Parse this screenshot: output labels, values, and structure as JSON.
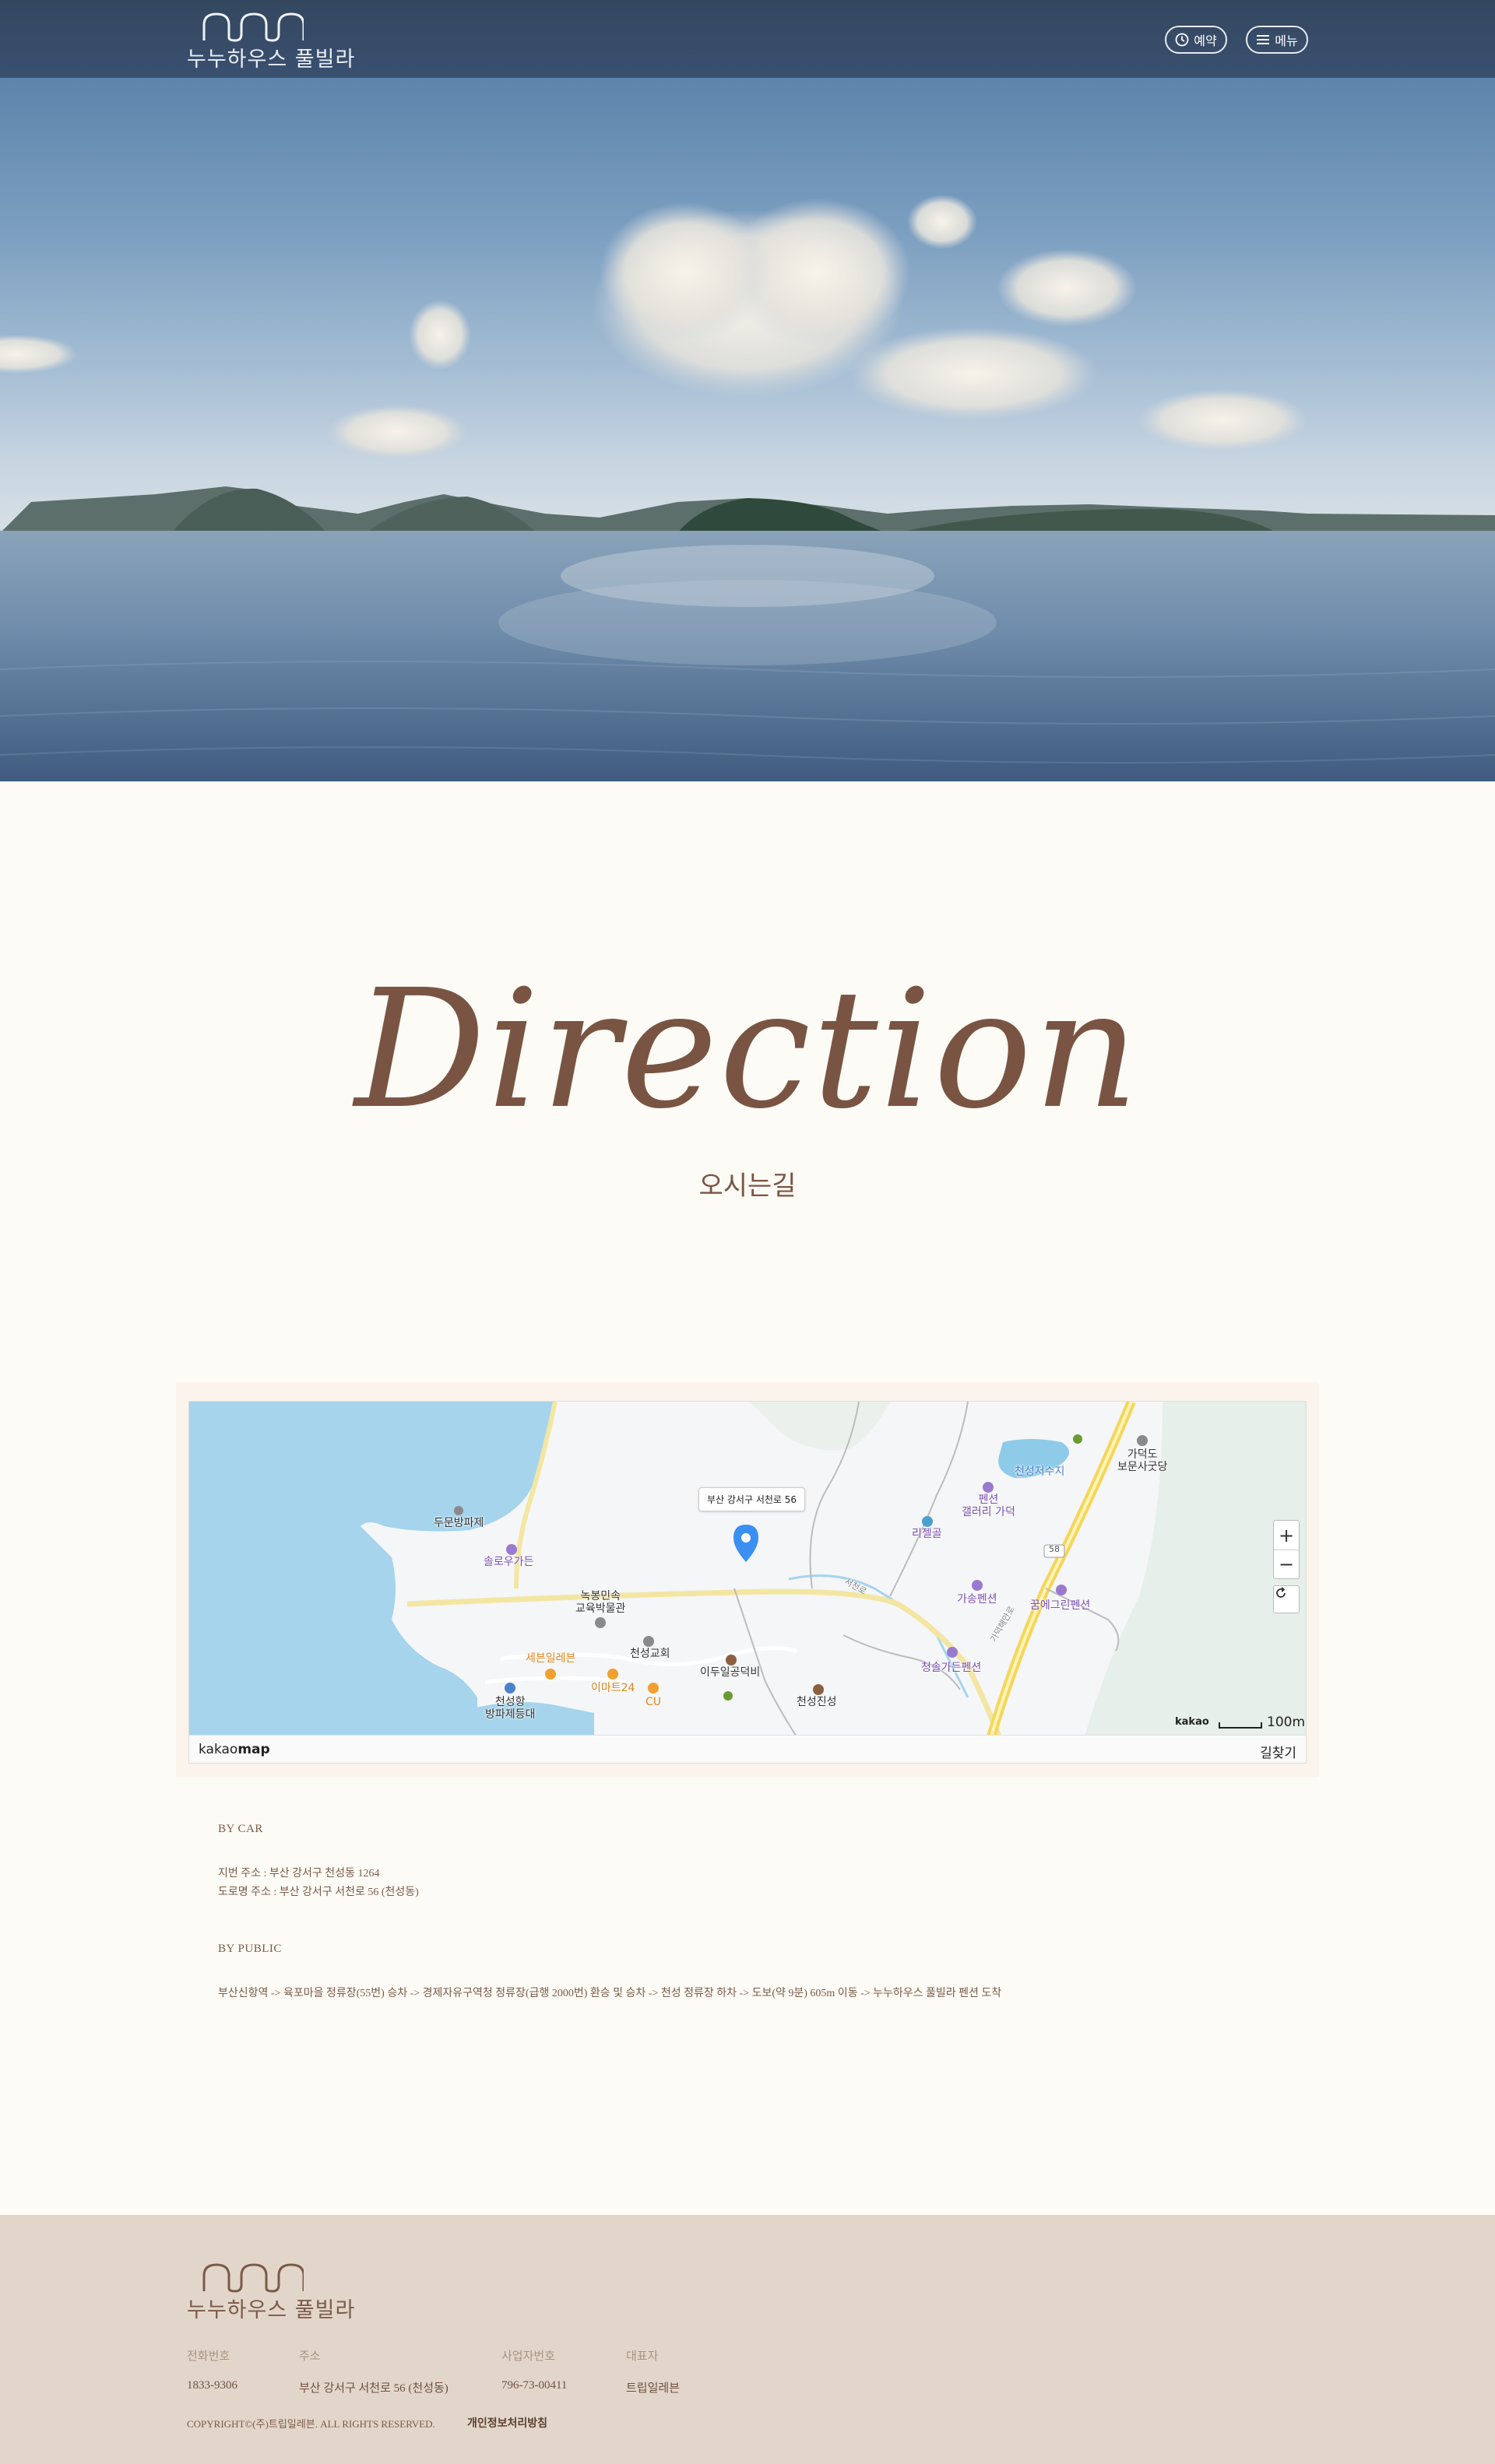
{
  "header": {
    "logo_text": "누누하우스 풀빌라",
    "reserve_label": "예약",
    "menu_label": "메뉴"
  },
  "section": {
    "title_script": "Direction",
    "title_kr": "오시는길"
  },
  "map": {
    "marker_address": "부산 강서구 서천로 56",
    "provider_logo_plain": "kakao",
    "provider_logo_bold": "map",
    "find_route": "길찾기",
    "scale_brand": "kakao",
    "scale_label": "100m",
    "zoom_in": "+",
    "zoom_out": "−",
    "labels": {
      "l1": "두문방파제",
      "l2": "솔로우가든",
      "l3": "녹봉민속\n교육박물관",
      "l4": "천성교회",
      "l5": "세븐일레븐",
      "l6": "이마트24",
      "l7": "CU",
      "l8": "천성항\n방파제등대",
      "l9": "이두일공덕비",
      "l10": "천성진성",
      "l11": "리젤골",
      "l12": "펜션\n갤러리 가덕",
      "l13": "천성저수지",
      "l14": "가덕도\n보문사굿당",
      "l15": "가송펜션",
      "l16": "꿈에그린펜션",
      "l17": "청솔가든펜션",
      "l18": "가덕해안로",
      "l19": "서천로",
      "l20": "58"
    }
  },
  "directions": {
    "by_car_title": "BY CAR",
    "lot_address": "지번 주소 : 부산 강서구 천성동 1264",
    "road_address": "도로명 주소 : 부산 강서구 서천로 56 (천성동)",
    "by_public_title": "BY PUBLIC",
    "public_route": "부산신항역 -> 육포마을 정류장(55번) 승차 -> 경제자유구역청 정류장(급행 2000번) 환승 및 승차 -> 천성 정류장 하차 -> 도보(약 9분) 605m 이동 -> 누누하우스 풀빌라 펜션 도착"
  },
  "footer": {
    "logo_text": "누누하우스 풀빌라",
    "phone_label": "전화번호",
    "phone_value": "1833-9306",
    "address_label": "주소",
    "address_value": "부산 강서구 서천로 56 (천성동)",
    "bizno_label": "사업자번호",
    "bizno_value": "796-73-00411",
    "ceo_label": "대표자",
    "ceo_value": "트립일레븐",
    "copyright": "COPYRIGHT©(주)트립일레븐. ALL RIGHTS RESERVED.",
    "privacy": "개인정보처리방침"
  },
  "icons": {
    "reserve": "clock-icon",
    "menu": "hamburger-icon",
    "marker": "map-pin-icon",
    "refresh": "refresh-icon"
  }
}
